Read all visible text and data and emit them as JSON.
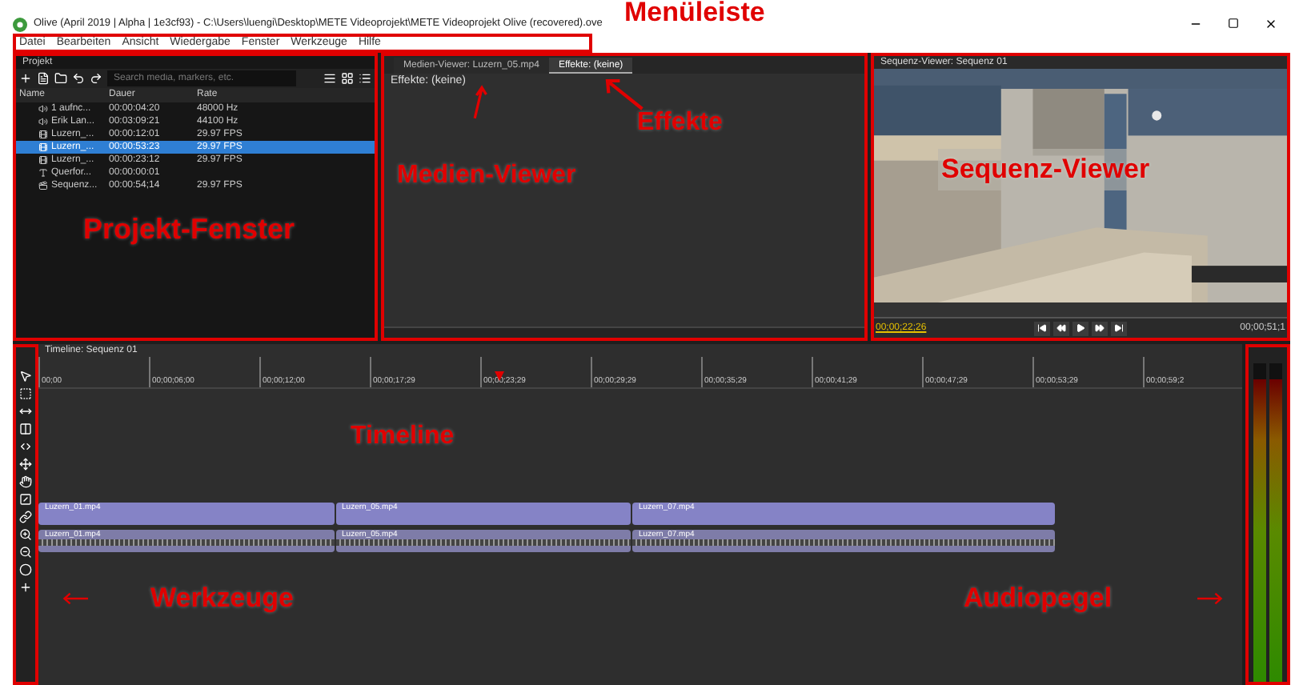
{
  "window": {
    "title": "Olive (April 2019 | Alpha | 1e3cf93) - C:\\Users\\luengi\\Desktop\\METE Videoprojekt\\METE Videoprojekt Olive (recovered).ove"
  },
  "menu": [
    "Datei",
    "Bearbeiten",
    "Ansicht",
    "Wiedergabe",
    "Fenster",
    "Werkzeuge",
    "Hilfe"
  ],
  "project": {
    "title": "Projekt",
    "search": {
      "placeholder": "Search media, markers, etc."
    },
    "columns": [
      "Name",
      "Dauer",
      "Rate"
    ],
    "rows": [
      {
        "kind": "audio",
        "name": "1 aufnc...",
        "duration": "00:00:04:20",
        "rate": "48000 Hz",
        "selected": false
      },
      {
        "kind": "audio",
        "name": "Erik Lan...",
        "duration": "00:03:09:21",
        "rate": "44100 Hz",
        "selected": false
      },
      {
        "kind": "video",
        "name": "Luzern_...",
        "duration": "00:00:12:01",
        "rate": "29.97 FPS",
        "selected": false
      },
      {
        "kind": "video",
        "name": "Luzern_...",
        "duration": "00:00:53:23",
        "rate": "29.97 FPS",
        "selected": true
      },
      {
        "kind": "video",
        "name": "Luzern_...",
        "duration": "00:00:23:12",
        "rate": "29.97 FPS",
        "selected": false
      },
      {
        "kind": "title",
        "name": "Querfor...",
        "duration": "00:00:00:01",
        "selected": false
      },
      {
        "kind": "sequence",
        "name": "Sequenz...",
        "duration": "00:00:54;14",
        "rate": "29.97 FPS",
        "selected": false
      }
    ]
  },
  "middle": {
    "tabs": [
      {
        "label": "Medien-Viewer: Luzern_05.mp4",
        "selected": false
      },
      {
        "label": "Effekte: (keine)",
        "selected": true
      }
    ],
    "effects_label": "Effekte: (keine)"
  },
  "sequence_viewer": {
    "title": "Sequenz-Viewer: Sequenz 01",
    "current_time": "00;00;22;26",
    "end_time": "00;00;51;1"
  },
  "timeline": {
    "title": "Timeline: Sequenz 01",
    "ruler": [
      "00;00",
      "00;00;06;00",
      "00;00;12;00",
      "00;00;17;29",
      "00;00;23;29",
      "00;00;29;29",
      "00;00;35;29",
      "00;00;41;29",
      "00;00;47;29",
      "00;00;53;29",
      "00;00;59;2"
    ],
    "video_clips": [
      "Luzern_01.mp4",
      "Luzern_05.mp4",
      "Luzern_07.mp4"
    ],
    "audio_clips": [
      "Luzern_01.mp4",
      "Luzern_05.mp4",
      "Luzern_07.mp4"
    ]
  },
  "audio_meter": {
    "channels": [
      {
        "level": 0.95
      },
      {
        "level": 0.95
      }
    ]
  },
  "annotations": {
    "menu": "Menüleiste",
    "effects": "Effekte",
    "media_viewer": "Medien-Viewer",
    "sequence_viewer": "Sequenz-Viewer",
    "project": "Projekt-Fenster",
    "timeline": "Timeline",
    "tools": "Werkzeuge",
    "audio": "Audiopegel"
  }
}
